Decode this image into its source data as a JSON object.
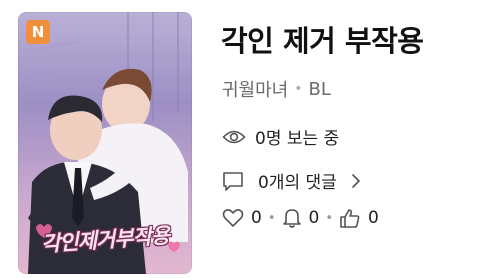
{
  "cover": {
    "badge": "N",
    "art_title": "각인제거부작용"
  },
  "work": {
    "title": "각인 제거 부작용",
    "author": "귀월마녀",
    "genre": "BL"
  },
  "viewers": {
    "text": "0명 보는 중"
  },
  "comments": {
    "text": "0개의 댓글"
  },
  "stats": {
    "likes": "0",
    "subscribes": "0",
    "recommends": "0"
  },
  "colors": {
    "badge": "#f1903c",
    "muted_text": "#6b6b6b",
    "icon_stroke": "#555555"
  }
}
